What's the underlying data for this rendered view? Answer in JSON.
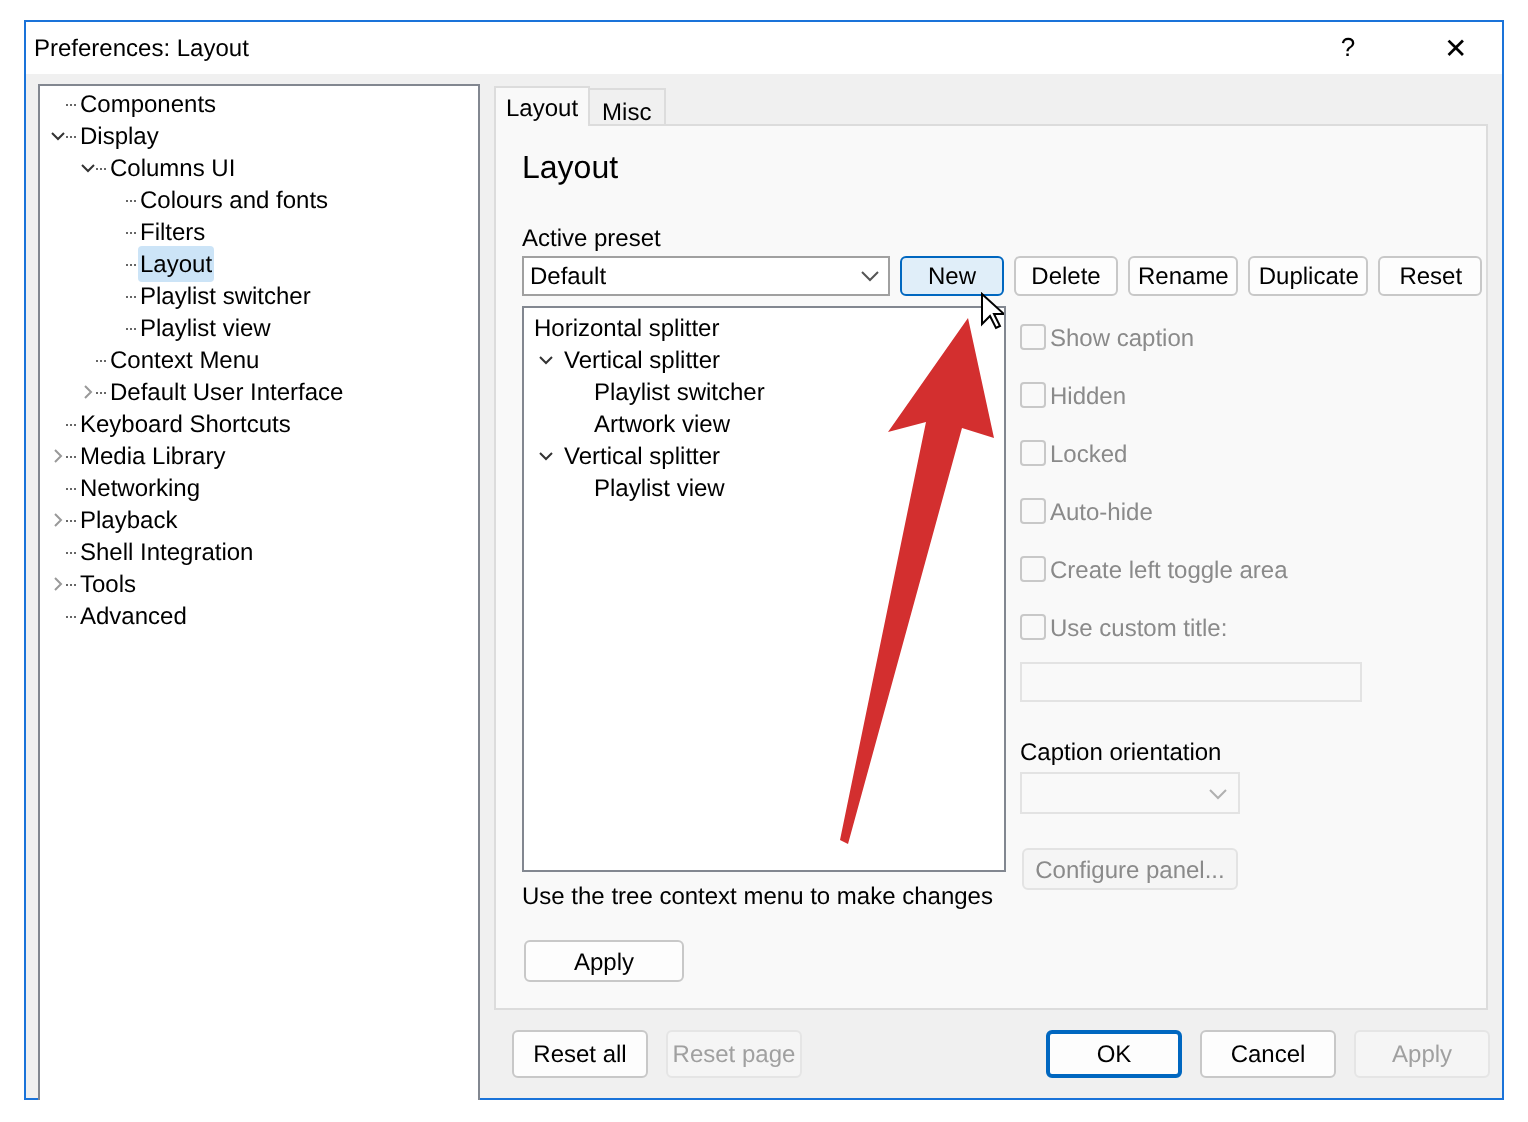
{
  "window": {
    "title": "Preferences: Layout",
    "help": "?",
    "close": "✕"
  },
  "nav_tree": [
    {
      "label": "Components",
      "selected": false
    },
    {
      "label": "Display",
      "expanded": true,
      "selected": false,
      "children": [
        {
          "label": "Columns UI",
          "expanded": true,
          "selected": false,
          "children": [
            {
              "label": "Colours and fonts",
              "selected": false
            },
            {
              "label": "Filters",
              "selected": false
            },
            {
              "label": "Layout",
              "selected": true
            },
            {
              "label": "Playlist switcher",
              "selected": false
            },
            {
              "label": "Playlist view",
              "selected": false
            }
          ]
        },
        {
          "label": "Context Menu",
          "selected": false
        },
        {
          "label": "Default User Interface",
          "expanded": false,
          "selected": false
        }
      ]
    },
    {
      "label": "Keyboard Shortcuts",
      "selected": false
    },
    {
      "label": "Media Library",
      "expanded": false,
      "selected": false
    },
    {
      "label": "Networking",
      "selected": false
    },
    {
      "label": "Playback",
      "expanded": false,
      "selected": false
    },
    {
      "label": "Shell Integration",
      "selected": false
    },
    {
      "label": "Tools",
      "expanded": false,
      "selected": false
    },
    {
      "label": "Advanced",
      "selected": false
    }
  ],
  "tabs": [
    {
      "label": "Layout",
      "selected": true
    },
    {
      "label": "Misc",
      "selected": false
    }
  ],
  "page": {
    "heading": "Layout",
    "preset_label": "Active preset",
    "preset_value": "Default",
    "preset_buttons": [
      {
        "label": "New",
        "hovered": true
      },
      {
        "label": "Delete",
        "hovered": false
      },
      {
        "label": "Rename",
        "hovered": false
      },
      {
        "label": "Duplicate",
        "hovered": false
      },
      {
        "label": "Reset",
        "hovered": false
      }
    ],
    "layout_tree": [
      {
        "label": "Horizontal splitter",
        "children": [
          {
            "label": "Vertical splitter",
            "expanded": true,
            "children": [
              {
                "label": "Playlist switcher"
              },
              {
                "label": "Artwork view"
              }
            ]
          },
          {
            "label": "Vertical splitter",
            "expanded": true,
            "children": [
              {
                "label": "Playlist view"
              }
            ]
          }
        ]
      }
    ],
    "options": [
      {
        "label": "Show caption",
        "checked": false,
        "disabled": true
      },
      {
        "label": "Hidden",
        "checked": false,
        "disabled": true
      },
      {
        "label": "Locked",
        "checked": false,
        "disabled": true
      },
      {
        "label": "Auto-hide",
        "checked": false,
        "disabled": true
      },
      {
        "label": "Create left toggle area",
        "checked": false,
        "disabled": true
      },
      {
        "label": "Use custom title:",
        "checked": false,
        "disabled": true
      }
    ],
    "caption_orientation_label": "Caption orientation",
    "configure_button": {
      "label": "Configure panel...",
      "disabled": true
    },
    "hint": "Use the tree context menu to make changes",
    "apply_button": {
      "label": "Apply",
      "disabled": false
    }
  },
  "footer_buttons": [
    {
      "label": "Reset all",
      "disabled": false,
      "default": false
    },
    {
      "label": "Reset page",
      "disabled": true,
      "default": false
    },
    {
      "label": "OK",
      "disabled": false,
      "default": true
    },
    {
      "label": "Cancel",
      "disabled": false,
      "default": false
    },
    {
      "label": "Apply",
      "disabled": true,
      "default": false
    }
  ]
}
